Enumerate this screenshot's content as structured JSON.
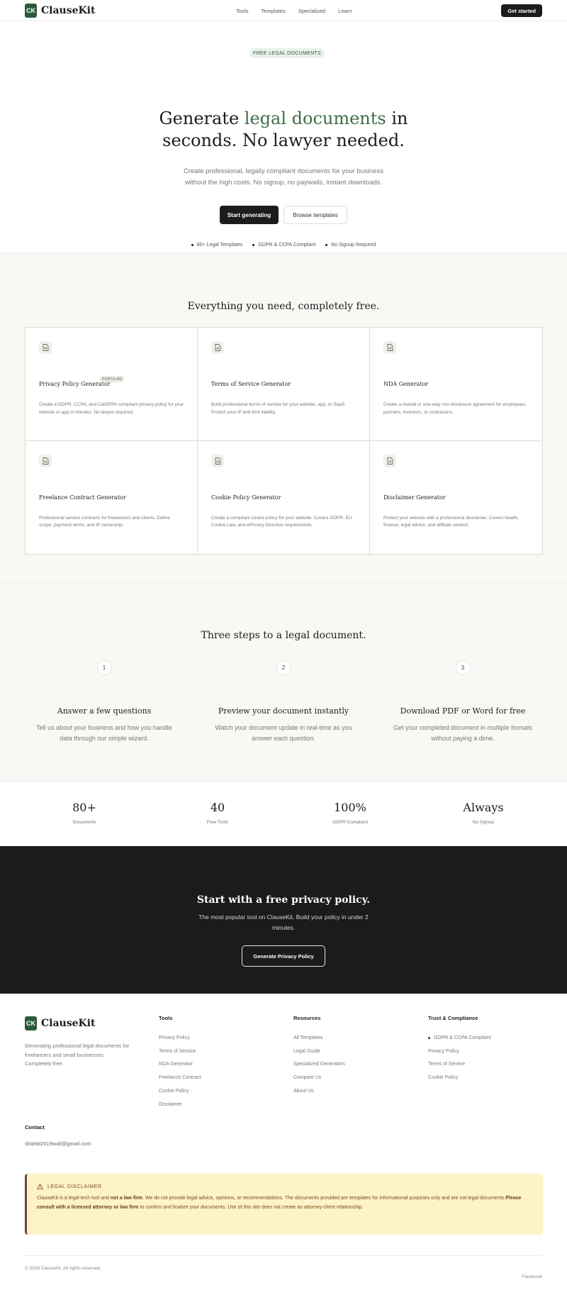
{
  "nav": {
    "logo_mark": "CK",
    "brand": "ClauseKit",
    "links": [
      "Tools",
      "Templates",
      "Specialized",
      "Learn"
    ],
    "cta": "Get started"
  },
  "hero": {
    "badge": "FREE LEGAL DOCUMENTS",
    "title_pre": "Generate ",
    "title_accent": "legal documents",
    "title_post": " in",
    "title_line2": "seconds. No lawyer needed.",
    "subtitle": "Create professional, legally compliant documents for your business without the high costs. No signup, no paywalls, instant downloads.",
    "primary_button": "Start generating",
    "secondary_button": "Browse templates",
    "trust_items": [
      "80+ Legal Templates",
      "GDPR & CCPA Compliant",
      "No Signup Required"
    ]
  },
  "features": {
    "title": "Everything you need, completely free.",
    "icon": "document-icon",
    "cards": [
      {
        "title": "Privacy Policy Generator",
        "badge": "POPULAR",
        "desc": "Create a GDPR, CCPA, and CalOPPA compliant privacy policy for your website or app in minutes. No lawyer required."
      },
      {
        "title": "Terms of Service Generator",
        "badge": "",
        "desc": "Build professional terms of service for your website, app, or SaaS. Protect your IP and limit liability."
      },
      {
        "title": "NDA Generator",
        "badge": "",
        "desc": "Create a mutual or one-way non-disclosure agreement for employees, partners, investors, or contractors."
      },
      {
        "title": "Freelance Contract Generator",
        "badge": "",
        "desc": "Professional service contracts for freelancers and clients. Define scope, payment terms, and IP ownership."
      },
      {
        "title": "Cookie Policy Generator",
        "badge": "",
        "desc": "Create a compliant cookie policy for your website. Covers GDPR, EU Cookie Law, and ePrivacy Directive requirements."
      },
      {
        "title": "Disclaimer Generator",
        "badge": "",
        "desc": "Protect your website with a professional disclaimer. Covers health, finance, legal advice, and affiliate content."
      }
    ]
  },
  "steps": {
    "title": "Three steps to a legal document.",
    "items": [
      {
        "num": "1",
        "title": "Answer a few questions",
        "desc": "Tell us about your business and how you handle data through our simple wizard."
      },
      {
        "num": "2",
        "title": "Preview your document instantly",
        "desc": "Watch your document update in real-time as you answer each question."
      },
      {
        "num": "3",
        "title": "Download PDF or Word for free",
        "desc": "Get your completed document in multiple formats without paying a dime."
      }
    ]
  },
  "stats": [
    {
      "value": "80+",
      "label": "Documents"
    },
    {
      "value": "40",
      "label": "Free Tools"
    },
    {
      "value": "100%",
      "label": "GDPR Compliant"
    },
    {
      "value": "Always",
      "label": "No Signup"
    }
  ],
  "cta": {
    "title": "Start with a free privacy policy.",
    "subtitle": "The most popular tool on ClauseKit. Build your policy in under 2 minutes.",
    "button": "Generate Privacy Policy"
  },
  "footer": {
    "brand": "ClauseKit",
    "description": "Generating professional legal documents for freelancers and small businesses. Completely free.",
    "columns": [
      {
        "heading": "Tools",
        "links": [
          "Privacy Policy",
          "Terms of Service",
          "NDA Generator",
          "Freelance Contract",
          "Cookie Policy",
          "Disclaimer"
        ]
      },
      {
        "heading": "Resources",
        "links": [
          "All Templates",
          "Legal Guide",
          "Specialized Generators",
          "Compare Us",
          "About Us"
        ]
      },
      {
        "heading": "Trust & Compliance",
        "links": [
          "GDPR & CCPA Compliant",
          "Privacy Policy",
          "Terms of Service",
          "Cookie Policy"
        ]
      }
    ],
    "contact_heading": "Contact",
    "contact_email": "shahid2019wali@gmail.com",
    "disclaimer": {
      "heading": "LEGAL DISCLAIMER",
      "p1": "ClauseKit is a legal-tech tool and ",
      "b1": "not a law firm",
      "p2": ". We do not provide legal advice, opinions, or recommendations. The documents provided are templates for informational purposes only and are not legal documents.",
      "b2": "Please consult with a licensed attorney or law firm",
      "p3": " to confirm and finalize your documents. Use of this site does not create an attorney-client relationship."
    },
    "copyright": "© 2026 ClauseKit. All rights reserved.",
    "social": "Facebook"
  },
  "colors": {
    "brand_green": "#2e5a3c",
    "accent_green": "#3e6e4a",
    "dark": "#1c1c1c",
    "cream_bg": "#f9f8f5",
    "disclaimer_bg": "#fdf3c8"
  }
}
